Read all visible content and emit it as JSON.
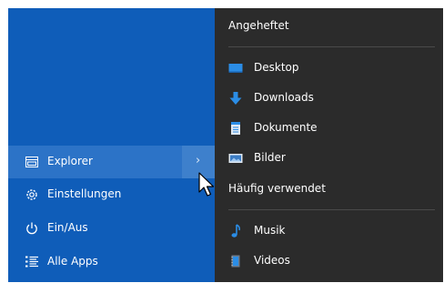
{
  "left_menu": {
    "explorer": {
      "label": "Explorer",
      "icon": "file-explorer-icon",
      "expand_icon": "chevron-right-icon",
      "expand_glyph": "›"
    },
    "settings": {
      "label": "Einstellungen",
      "icon": "gear-icon"
    },
    "power": {
      "label": "Ein/Aus",
      "icon": "power-icon"
    },
    "all_apps": {
      "label": "Alle Apps",
      "icon": "list-icon"
    }
  },
  "jump_list": {
    "pinned_heading": "Angeheftet",
    "pinned": [
      {
        "label": "Desktop",
        "icon": "desktop-icon"
      },
      {
        "label": "Downloads",
        "icon": "download-arrow-icon"
      },
      {
        "label": "Dokumente",
        "icon": "documents-icon"
      },
      {
        "label": "Bilder",
        "icon": "pictures-icon"
      }
    ],
    "frequent_heading": "Häufig verwendet",
    "frequent": [
      {
        "label": "Musik",
        "icon": "music-note-icon"
      },
      {
        "label": "Videos",
        "icon": "videos-icon"
      }
    ]
  },
  "colors": {
    "start_blue": "#0f5db9",
    "highlight_blue": "#2c73c7",
    "jump_list_bg": "#2b2b2b",
    "icon_blue": "#2b8de6"
  }
}
